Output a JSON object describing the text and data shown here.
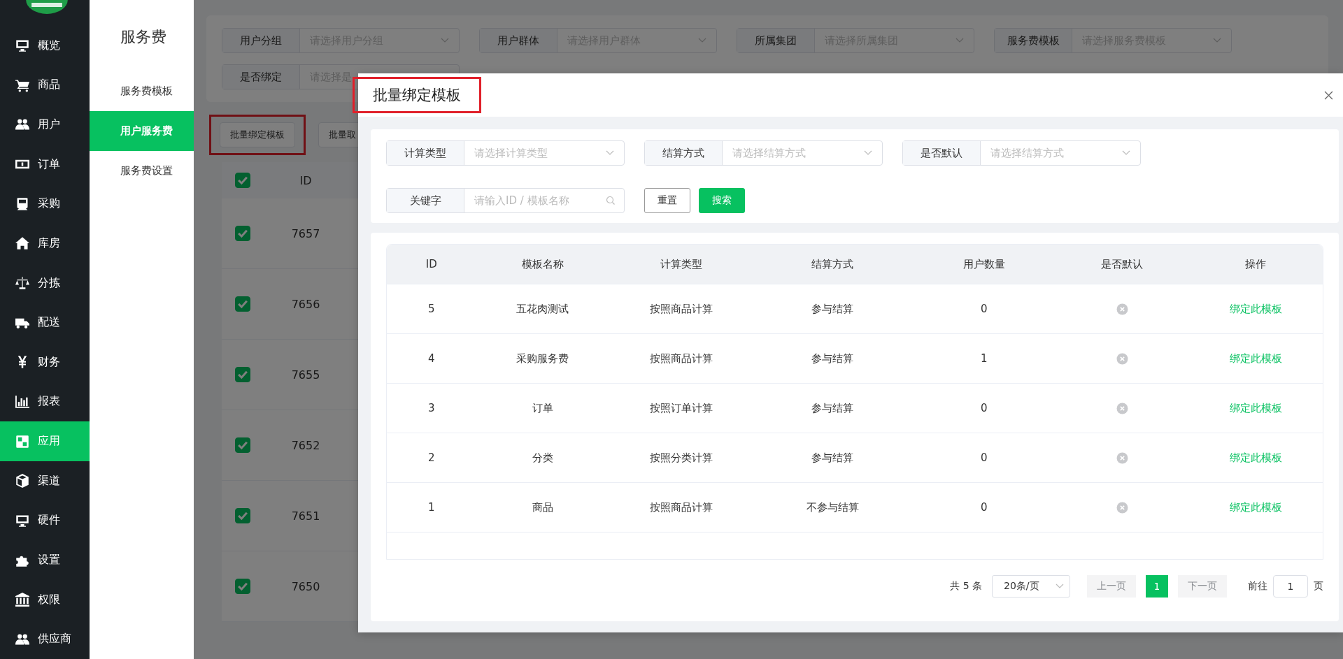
{
  "sidebar": {
    "items": [
      {
        "label": "概览",
        "selected": false
      },
      {
        "label": "商品",
        "selected": false
      },
      {
        "label": "用户",
        "selected": false
      },
      {
        "label": "订单",
        "selected": false
      },
      {
        "label": "采购",
        "selected": false
      },
      {
        "label": "库房",
        "selected": false
      },
      {
        "label": "分拣",
        "selected": false
      },
      {
        "label": "配送",
        "selected": false
      },
      {
        "label": "财务",
        "selected": false
      },
      {
        "label": "报表",
        "selected": false
      },
      {
        "label": "应用",
        "selected": true
      },
      {
        "label": "渠道",
        "selected": false
      },
      {
        "label": "硬件",
        "selected": false
      },
      {
        "label": "设置",
        "selected": false
      },
      {
        "label": "权限",
        "selected": false
      },
      {
        "label": "供应商",
        "selected": false
      }
    ]
  },
  "subnav": {
    "title": "服务费",
    "items": [
      {
        "label": "服务费模板",
        "selected": false
      },
      {
        "label": "用户服务费",
        "selected": true
      },
      {
        "label": "服务费设置",
        "selected": false
      }
    ]
  },
  "page": {
    "filters": [
      {
        "label": "用户分组",
        "placeholder": "请选择用户分组"
      },
      {
        "label": "用户群体",
        "placeholder": "请选择用户群体"
      },
      {
        "label": "所属集团",
        "placeholder": "请选择所属集团"
      },
      {
        "label": "服务费模板",
        "placeholder": "请选择服务费模板"
      },
      {
        "label": "是否绑定",
        "placeholder": "请选择是"
      }
    ],
    "actions": [
      "批量绑定模板",
      "批量取"
    ],
    "table": {
      "columns": [
        "ID"
      ],
      "header_checked": true,
      "rows": [
        {
          "id": "7657",
          "checked": true
        },
        {
          "id": "7656",
          "checked": true
        },
        {
          "id": "7655",
          "checked": true
        },
        {
          "id": "7652",
          "checked": true
        },
        {
          "id": "7651",
          "checked": true
        },
        {
          "id": "7650",
          "checked": true
        }
      ]
    }
  },
  "dialog": {
    "title": "批量绑定模板",
    "filters": [
      {
        "label": "计算类型",
        "placeholder": "请选择计算类型",
        "kind": "select"
      },
      {
        "label": "结算方式",
        "placeholder": "请选择结算方式",
        "kind": "select"
      },
      {
        "label": "是否默认",
        "placeholder": "请选择结算方式",
        "kind": "select"
      },
      {
        "label": "关键字",
        "placeholder": "请输入ID / 模板名称",
        "kind": "search"
      }
    ],
    "buttons": [
      {
        "label": "重置",
        "kind": "plain"
      },
      {
        "label": "搜索",
        "kind": "primary"
      }
    ],
    "table": {
      "columns": [
        "ID",
        "模板名称",
        "计算类型",
        "结算方式",
        "用户数量",
        "是否默认",
        "操作"
      ],
      "rows": [
        {
          "id": "5",
          "name": "五花肉测试",
          "calc": "按照商品计算",
          "settle": "参与结算",
          "users": "0",
          "is_default": false,
          "action": "绑定此模板"
        },
        {
          "id": "4",
          "name": "采购服务费",
          "calc": "按照商品计算",
          "settle": "参与结算",
          "users": "1",
          "is_default": false,
          "action": "绑定此模板"
        },
        {
          "id": "3",
          "name": "订单",
          "calc": "按照订单计算",
          "settle": "参与结算",
          "users": "0",
          "is_default": false,
          "action": "绑定此模板"
        },
        {
          "id": "2",
          "name": "分类",
          "calc": "按照分类计算",
          "settle": "参与结算",
          "users": "0",
          "is_default": false,
          "action": "绑定此模板"
        },
        {
          "id": "1",
          "name": "商品",
          "calc": "按照商品计算",
          "settle": "不参与结算",
          "users": "0",
          "is_default": false,
          "action": "绑定此模板"
        }
      ]
    },
    "pagination": {
      "total": "共 5 条",
      "page_size": "20条/页",
      "prev": "上一页",
      "pages": [
        {
          "label": "1",
          "selected": true
        }
      ],
      "next": "下一页",
      "goto_label": "前往",
      "goto_value": "1",
      "goto_suffix": "页"
    }
  }
}
